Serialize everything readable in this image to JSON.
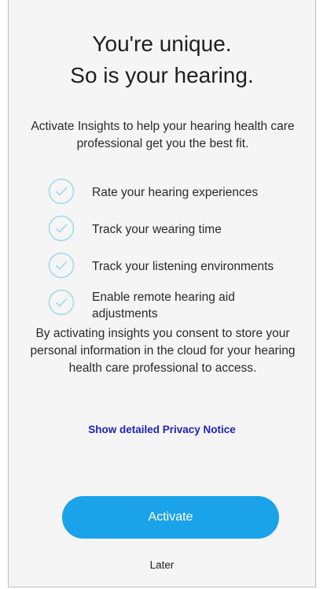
{
  "headline": {
    "line1": "You're unique.",
    "line2": "So is your hearing."
  },
  "intro": "Activate Insights to help your hearing health care professional get you the best fit.",
  "features": [
    {
      "icon": "check-circle-icon",
      "label": "Rate your hearing experiences"
    },
    {
      "icon": "check-circle-icon",
      "label": "Track your wearing time"
    },
    {
      "icon": "check-circle-icon",
      "label": "Track your listening environments"
    },
    {
      "icon": "check-circle-icon",
      "label": "Enable remote hearing aid adjustments"
    }
  ],
  "consent": "By activating insights you consent to store your personal information in the cloud for your hearing health care professional to access.",
  "privacy_link": "Show detailed Privacy Notice",
  "actions": {
    "activate_label": "Activate",
    "later_label": "Later"
  },
  "colors": {
    "accent": "#1aa3e8",
    "link": "#1f24b5",
    "check_icon": "#9fd8ee",
    "background": "#f5f5f5"
  }
}
